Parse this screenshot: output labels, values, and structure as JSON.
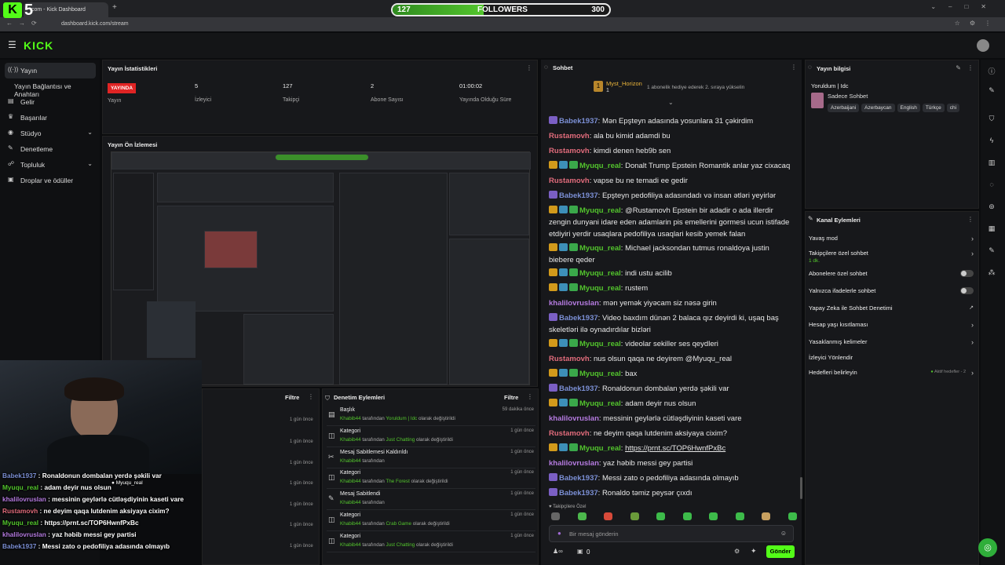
{
  "browser": {
    "tab_title": "com - Kick Dashboard",
    "url": "dashboard.kick.com/stream",
    "overlay_logo_number": "5"
  },
  "followers_goal": {
    "current": "127",
    "label": "FOLLOWERS",
    "target": "300",
    "progress": 0.42
  },
  "header": {
    "logo": "KICK"
  },
  "sidebar": {
    "items": [
      {
        "label": "Yayın"
      },
      {
        "label": "Yayın Bağlantısı ve Anahtarı"
      },
      {
        "label": "Gelir"
      },
      {
        "label": "Başarılar"
      },
      {
        "label": "Stüdyo"
      },
      {
        "label": "Denetleme"
      },
      {
        "label": "Topluluk"
      },
      {
        "label": "Droplar ve ödüller"
      }
    ]
  },
  "stats": {
    "title": "Yayın İstatistikleri",
    "live_badge": "YAYINDA",
    "live_label": "Yayın",
    "viewers": "5",
    "viewers_label": "İzleyici",
    "followers": "127",
    "followers_label": "Takipçi",
    "subs": "2",
    "subs_label": "Abone Sayısı",
    "uptime": "01:00:02",
    "uptime_label": "Yayında Olduğu Süre"
  },
  "preview": {
    "title": "Yayın Ön İzlemesi"
  },
  "left_bottom": {
    "filter": "Filtre",
    "times": [
      "1 gün önce",
      "1 gün önce",
      "1 gün önce",
      "1 gün önce",
      "1 gün önce",
      "1 gün önce",
      "1 gün önce"
    ]
  },
  "moderation": {
    "title": "Denetim Eylemleri",
    "filter": "Filtre",
    "rows": [
      {
        "title": "Başlık",
        "user": "Khabib44",
        "mid": " tarafından ",
        "target": "Yoruldum | Idc",
        "suffix": " olarak değiştirildi",
        "time": "59 dakika önce"
      },
      {
        "title": "Kategori",
        "user": "Khabib44",
        "mid": " tarafından ",
        "target": "Just Chatting",
        "suffix": " olarak değiştirildi",
        "time": "1 gün önce"
      },
      {
        "title": "Mesaj Sabitlemesi Kaldırıldı",
        "user": "Khabib44",
        "mid": " tarafından",
        "target": "",
        "suffix": "",
        "time": "1 gün önce"
      },
      {
        "title": "Kategori",
        "user": "Khabib44",
        "mid": " tarafından ",
        "target": "The Forest",
        "suffix": " olarak değiştirildi",
        "time": "1 gün önce"
      },
      {
        "title": "Mesaj Sabitlendi",
        "user": "Khabib44",
        "mid": " tarafından",
        "target": "",
        "suffix": "",
        "time": "1 gün önce"
      },
      {
        "title": "Kategori",
        "user": "Khabib44",
        "mid": " tarafından ",
        "target": "Crab Game",
        "suffix": " olarak değiştirildi",
        "time": "1 gün önce"
      },
      {
        "title": "Kategori",
        "user": "Khabib44",
        "mid": " tarafından ",
        "target": "Just Chatting",
        "suffix": " olarak değiştirildi",
        "time": "1 gün önce"
      }
    ]
  },
  "chat": {
    "title": "Sohbet",
    "pinned_user": "Myst_Horizon",
    "pinned_count": "1",
    "pinned_text": "1 abonelik hediye ederek 2. sıraya yükselin",
    "messages": [
      {
        "user": "Babek1937",
        "color": "#7b8fd4",
        "text": "Mən Epşteyn adasında yosunlara 31 çəkirdim"
      },
      {
        "user": "Rustamovh",
        "color": "#e06b7b",
        "text": "ala bu kimid adamdi bu"
      },
      {
        "user": "Rustamovh",
        "color": "#e06b7b",
        "text": "kimdi denen heb9b sen"
      },
      {
        "user": "Myuqu_real",
        "color": "#53c52d",
        "text": "Donalt Trump Epstein Romantik anlar yaz cixacaq"
      },
      {
        "user": "Rustamovh",
        "color": "#e06b7b",
        "text": "vapse bu ne temadi ee gedir"
      },
      {
        "user": "Babek1937",
        "color": "#7b8fd4",
        "text": "Epşteyn pedofiliya adasındadı və insan ətləri yeyirlər"
      },
      {
        "user": "Myuqu_real",
        "color": "#53c52d",
        "text": "@Rustamovh Epstein bir adadir o ada illerdir zengin dunyani idare eden adamlarin pis emellerini gormesi ucun istifade etdiyiri yerdir usaqlara pedofiliya usaqlari kesib yemek falan"
      },
      {
        "user": "Myuqu_real",
        "color": "#53c52d",
        "text": "Michael jacksondan tutmus ronaldoya justin biebere qeder"
      },
      {
        "user": "Myuqu_real",
        "color": "#53c52d",
        "text": "indi ustu acilib"
      },
      {
        "user": "Myuqu_real",
        "color": "#53c52d",
        "text": "rustem"
      },
      {
        "user": "khalilovruslan",
        "color": "#b57be0",
        "text": "mən yemək yiyəcam siz nəsə girin"
      },
      {
        "user": "Babek1937",
        "color": "#7b8fd4",
        "text": "Video baxdım dünən 2 balaca qız deyirdi ki, uşaq baş skeletləri ilə oynadırdılar bizləri"
      },
      {
        "user": "Myuqu_real",
        "color": "#53c52d",
        "text": "videolar sekiller ses qeydleri"
      },
      {
        "user": "Rustamovh",
        "color": "#e06b7b",
        "text": "nus olsun qaqa ne deyirem @Myuqu_real"
      },
      {
        "user": "Myuqu_real",
        "color": "#53c52d",
        "text": "bax"
      },
      {
        "user": "Babek1937",
        "color": "#7b8fd4",
        "text": "Ronaldonun dombalan yerdə şəkili var"
      },
      {
        "user": "Myuqu_real",
        "color": "#53c52d",
        "text": "adam deyir nus olsun"
      },
      {
        "user": "khalilovruslan",
        "color": "#b57be0",
        "text": "messinin geylərlə cütləşdiyinin kaseti vare"
      },
      {
        "user": "Rustamovh",
        "color": "#e06b7b",
        "text": "ne deyim qaqa lutdenim aksiyaya cixim?"
      },
      {
        "user": "Myuqu_real",
        "color": "#53c52d",
        "text": "https://prnt.sc/TOP6HwnfPxBc"
      },
      {
        "user": "khalilovruslan",
        "color": "#b57be0",
        "text": "yaz həbib messi gey partisi"
      },
      {
        "user": "Babek1937",
        "color": "#7b8fd4",
        "text": "Messi zato o pedofiliya adasında olmayıb"
      },
      {
        "user": "Babek1937",
        "color": "#7b8fd4",
        "text": "Ronaldo təmiz peysər çıxdı"
      }
    ],
    "followers_only": "Takipçilere Özel",
    "input_placeholder": "Bir mesaj gönderin",
    "points": "0",
    "send": "Gönder"
  },
  "overlay_chat": [
    {
      "user": "Babek1937",
      "color": "#7b8fd4",
      "text": " : Ronaldonun dombalan yerdə şəkili var"
    },
    {
      "user": "Myuqu_real",
      "color": "#53c52d",
      "text": " : adam deyir nus olsun"
    },
    {
      "user": "khalilovruslan",
      "color": "#b57be0",
      "text": " : messinin geylərlə cütləşdiyinin kaseti vare"
    },
    {
      "user": "Rustamovh",
      "color": "#e06b7b",
      "text": " : ne deyim qaqa lutdenim aksiyaya cixim?"
    },
    {
      "user": "Myuqu_real",
      "color": "#53c52d",
      "text": " : https://prnt.sc/TOP6HwnfPxBc"
    },
    {
      "user": "khalilovruslan",
      "color": "#b57be0",
      "text": " : yaz həbib messi gey partisi"
    },
    {
      "user": "Babek1937",
      "color": "#7b8fd4",
      "text": " : Messi zato o pedofiliya adasında olmayıb"
    }
  ],
  "stream_info": {
    "title": "Yayın bilgisi",
    "stream_title": "Yoruldum | Idc",
    "mode": "Sadece Sohbet",
    "tags": [
      "Azerbaijani",
      "Azerbaycan",
      "English",
      "Türkçe",
      "chi"
    ]
  },
  "channel_actions": {
    "title": "Kanal Eylemleri",
    "slow_mode": "Yavaş mod",
    "followers_chat": "Takipçilere özel sohbet",
    "followers_chat_sub": "1 dk.",
    "subs_chat": "Abonelere özel sohbet",
    "emote_chat": "Yalnızca ifadelerle sohbet",
    "ai_mod": "Yapay Zeka ile Sohbet Denetimi",
    "age_limit": "Hesap yaşı kısıtlaması",
    "banned_words": "Yasaklanmış kelimeler",
    "raid": "İzleyici Yönlendir",
    "goals": "Hedefleri belirleyin",
    "goals_sub": "Aktif hedefler - 2"
  }
}
